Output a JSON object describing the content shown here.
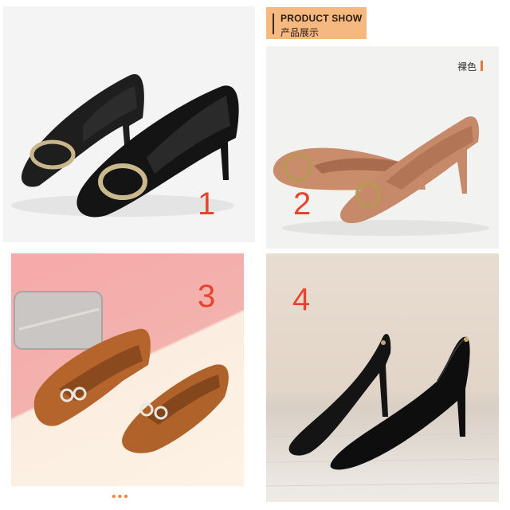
{
  "header": {
    "title_en": "PRODUCT SHOW",
    "title_cn": "产品展示"
  },
  "products": [
    {
      "number": "1"
    },
    {
      "number": "2",
      "color_label": "裸色"
    },
    {
      "number": "3"
    },
    {
      "number": "4"
    }
  ],
  "pager": {
    "dots": "•••"
  },
  "colors": {
    "number_red": "#e8442d",
    "header_bg": "#f5b87f",
    "dots": "#f08a3c"
  }
}
